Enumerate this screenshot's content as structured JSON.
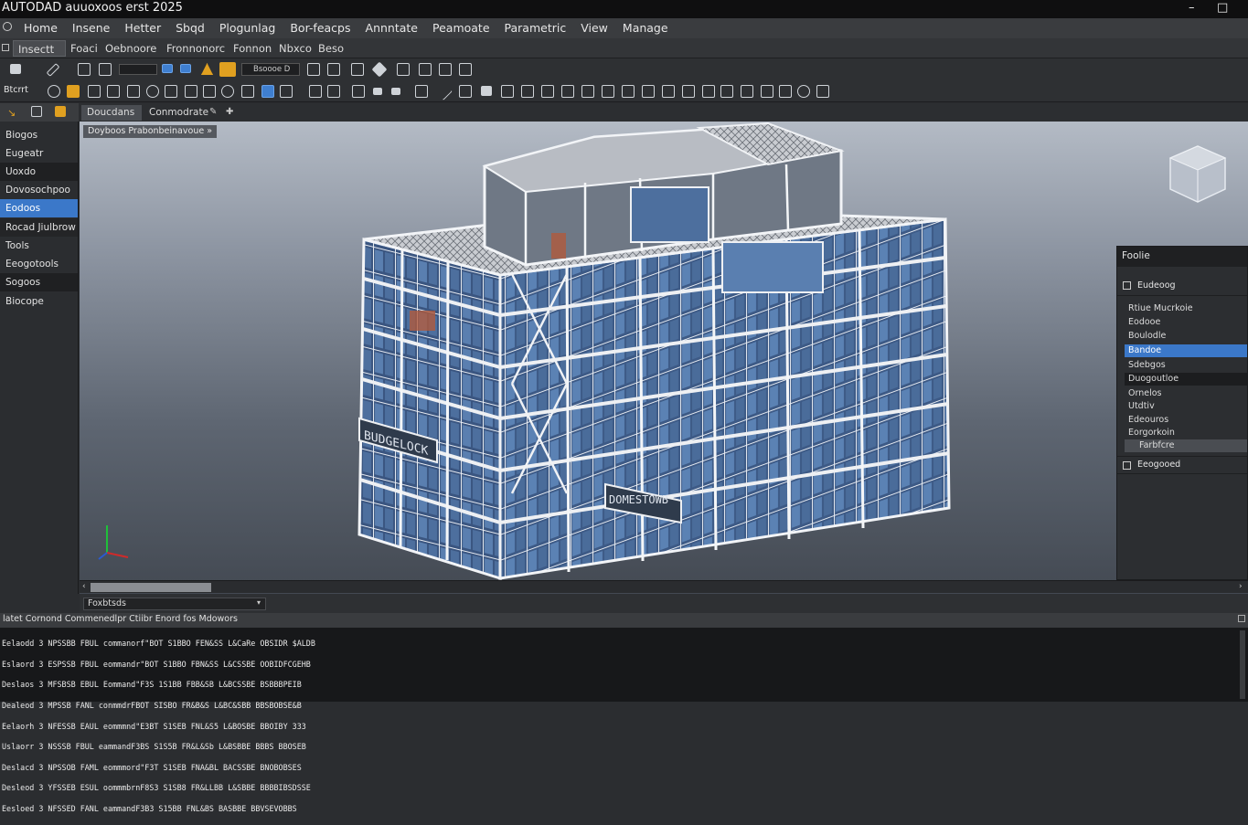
{
  "app": {
    "title": "AUTODAD auuoxoos erst 2025",
    "window_controls": [
      "–",
      "□"
    ]
  },
  "menu": {
    "items": [
      "Home",
      "Insene",
      "Hetter",
      "Sbqd",
      "Plogunlag",
      "Bor-feacps",
      "Annntate",
      "Peamoate",
      "Parametric",
      "View",
      "Manage"
    ]
  },
  "ribbon_tabs": {
    "items": [
      "Insectt",
      "Foaci",
      "Oebnoore",
      "Fronnonorc",
      "Fonnon",
      "Nbxco",
      "Beso"
    ],
    "active": "Insectt"
  },
  "toolbar": {
    "style_box": "Bsoooe D",
    "left_label": "Btcrrt"
  },
  "left_panel": {
    "items": [
      "Biogos",
      "Eugeatr",
      "Uoxdo",
      "Dovosochpoo",
      "Eodoos",
      "Rocad Jiulbrow",
      "Tools",
      "Eeogotools",
      "Sogoos",
      "Biocope"
    ],
    "selected": "Eodoos"
  },
  "viewport": {
    "tabs": [
      "Doucdans",
      "Conmodrate"
    ],
    "active_tab": "Doucdans",
    "breadcrumb": "Doyboos Prabonbeinavoue »",
    "signs": [
      "BUDGELOCK",
      "DOMESTOWB"
    ]
  },
  "properties_panel": {
    "title": "Foolie",
    "section": "Eudeoog",
    "items": [
      "Rtiue Mucrkoie",
      "Eodooe",
      "Boulodle",
      "Bandoe",
      "Sdebgos",
      "Duogoutloe",
      "Ornelos",
      "Utdtiv",
      "Edeouros",
      "Eorgorkoin",
      "Farbfcre"
    ],
    "selected": "Bandoe",
    "footer": "Eeogooed"
  },
  "model_selector": {
    "value": "Foxbtsds"
  },
  "command": {
    "header": "latet Cornond Commenedlpr Ctiibr Enord fos Mdowors",
    "lines": [
      "Eelaodd 3 NPSSBB FBUL commanorf\"BOT S1BBO FEN&SS L&CaRe OBSIDR $ALDB",
      "Eslaord 3 ESPSSB FBUL eommandr\"BOT S1BBO FBN&SS L&CSSBE OOBIDFCGEHB",
      "Deslaos 3 MFSBSB EBUL Eommand\"F3S 1S1BB FBB&SB L&BCSSBE BSBBBPEIB",
      "Dealeod 3 MPSSB FANL conmmdrFBOT SISBO FR&B&S L&BC&SBB BBSBOBSE&B",
      "Eelaorh 3 NFESSB EAUL eommmnd\"E3BT S1SEB FNL&S5 L&BOSBE BBOIBY 333",
      "Uslaorr 3 NSSSB FBUL eammandF3BS S1S5B FR&L&Sb L&BSBBE BBBS BBOSEB",
      "Deslacd 3 NPSSOB FAML eommmord\"F3T S1SEB FNA&BL BACSSBE BNOBOBSES",
      "Desleod 3 YFSSEB ESUL oommmbrnF8S3 S1SB8 FR&LLBB L&SBBE BBBBIBSDSSE",
      "Eesloed 3 NFSSED FANL eammandF3B3 S15BB FNL&BS BASBBE BBVSEVOBBS"
    ]
  }
}
